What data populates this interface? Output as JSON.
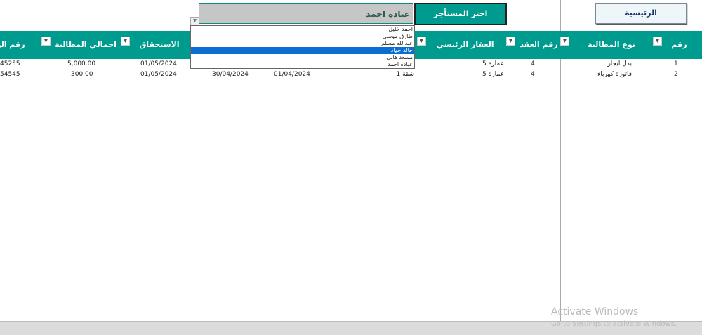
{
  "home_button": "الرئيسية",
  "tenant_label": "اختر المستأجر",
  "tenant_selected": "عباده احمد",
  "tenant_options": [
    "احمد خليل",
    "طارق موسى",
    "عبدالله مسلم",
    "خالد جهاد",
    "مسعد هاني",
    "عباده احمد"
  ],
  "highlighted_option_index": 3,
  "headers": {
    "claim_no": "رقم المطالبة",
    "claim_type": "نوع المطالبة",
    "contract_no": "رقم العقد",
    "main_property": "العقار الرئيسي",
    "due_date": "الاستحقاق بتاريخ",
    "total": "اجمالي المطالبة",
    "receipt_no": "رقم الوص"
  },
  "rows": [
    {
      "claim_no": "1",
      "claim_type": "بدل ايجار",
      "contract_no": "4",
      "main_property": "عمارة 5",
      "unit": "",
      "from": "",
      "to": "",
      "due_date": "01/05/2024",
      "total": "5,000.00",
      "receipt_no": "45255"
    },
    {
      "claim_no": "2",
      "claim_type": "فاتورة كهرباء",
      "contract_no": "4",
      "main_property": "عمارة 5",
      "unit": "شقة 1",
      "from": "01/04/2024",
      "to": "30/04/2024",
      "due_date": "01/05/2024",
      "total": "300.00",
      "receipt_no": "54545"
    }
  ],
  "watermark": {
    "title": "Activate Windows",
    "subtitle": "Go to Settings to activate Windows."
  }
}
